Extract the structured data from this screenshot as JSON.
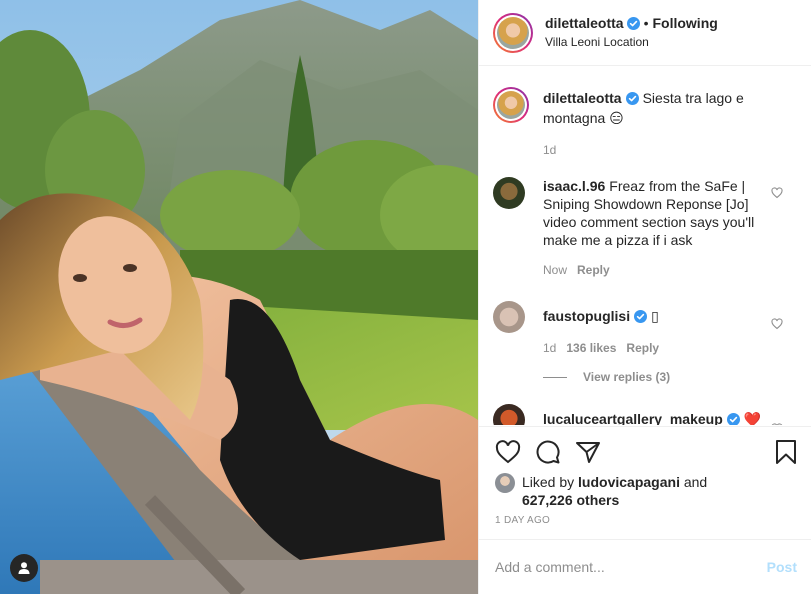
{
  "post": {
    "author": "dilettaleotta",
    "follow_status": "Following",
    "separator": "•",
    "location": "Villa Leoni Location"
  },
  "caption": {
    "username": "dilettaleotta",
    "text": "Siesta tra lago e montagna 😑",
    "age": "1d"
  },
  "comments": [
    {
      "username": "isaac.l.96",
      "text": "Freaz from the SaFe | Sniping Showdown Reponse [Jo] video comment section says you'll make me a pizza if i ask",
      "time": "Now",
      "reply_label": "Reply"
    },
    {
      "username": "faustopuglisi",
      "text": "▯",
      "time": "1d",
      "likes": "136 likes",
      "reply_label": "Reply",
      "view_replies": "View replies (3)"
    },
    {
      "username": "lucaluceartgallery_makeup",
      "text": "❤️"
    }
  ],
  "likes": {
    "prefix": "Liked by",
    "user": "ludovicapagani",
    "conj": "and",
    "others": "627,226 others"
  },
  "timestamp": "1 DAY AGO",
  "comment_box": {
    "placeholder": "Add a comment...",
    "post_label": "Post"
  },
  "colors": {
    "verified": "#3897f0",
    "post_button": "#b2dffc",
    "muted": "#8e8e8e",
    "heart": "#ed4956"
  },
  "icons": [
    "heart-icon",
    "comment-icon",
    "share-icon",
    "bookmark-icon",
    "user-tag-icon",
    "verified-badge-icon"
  ]
}
